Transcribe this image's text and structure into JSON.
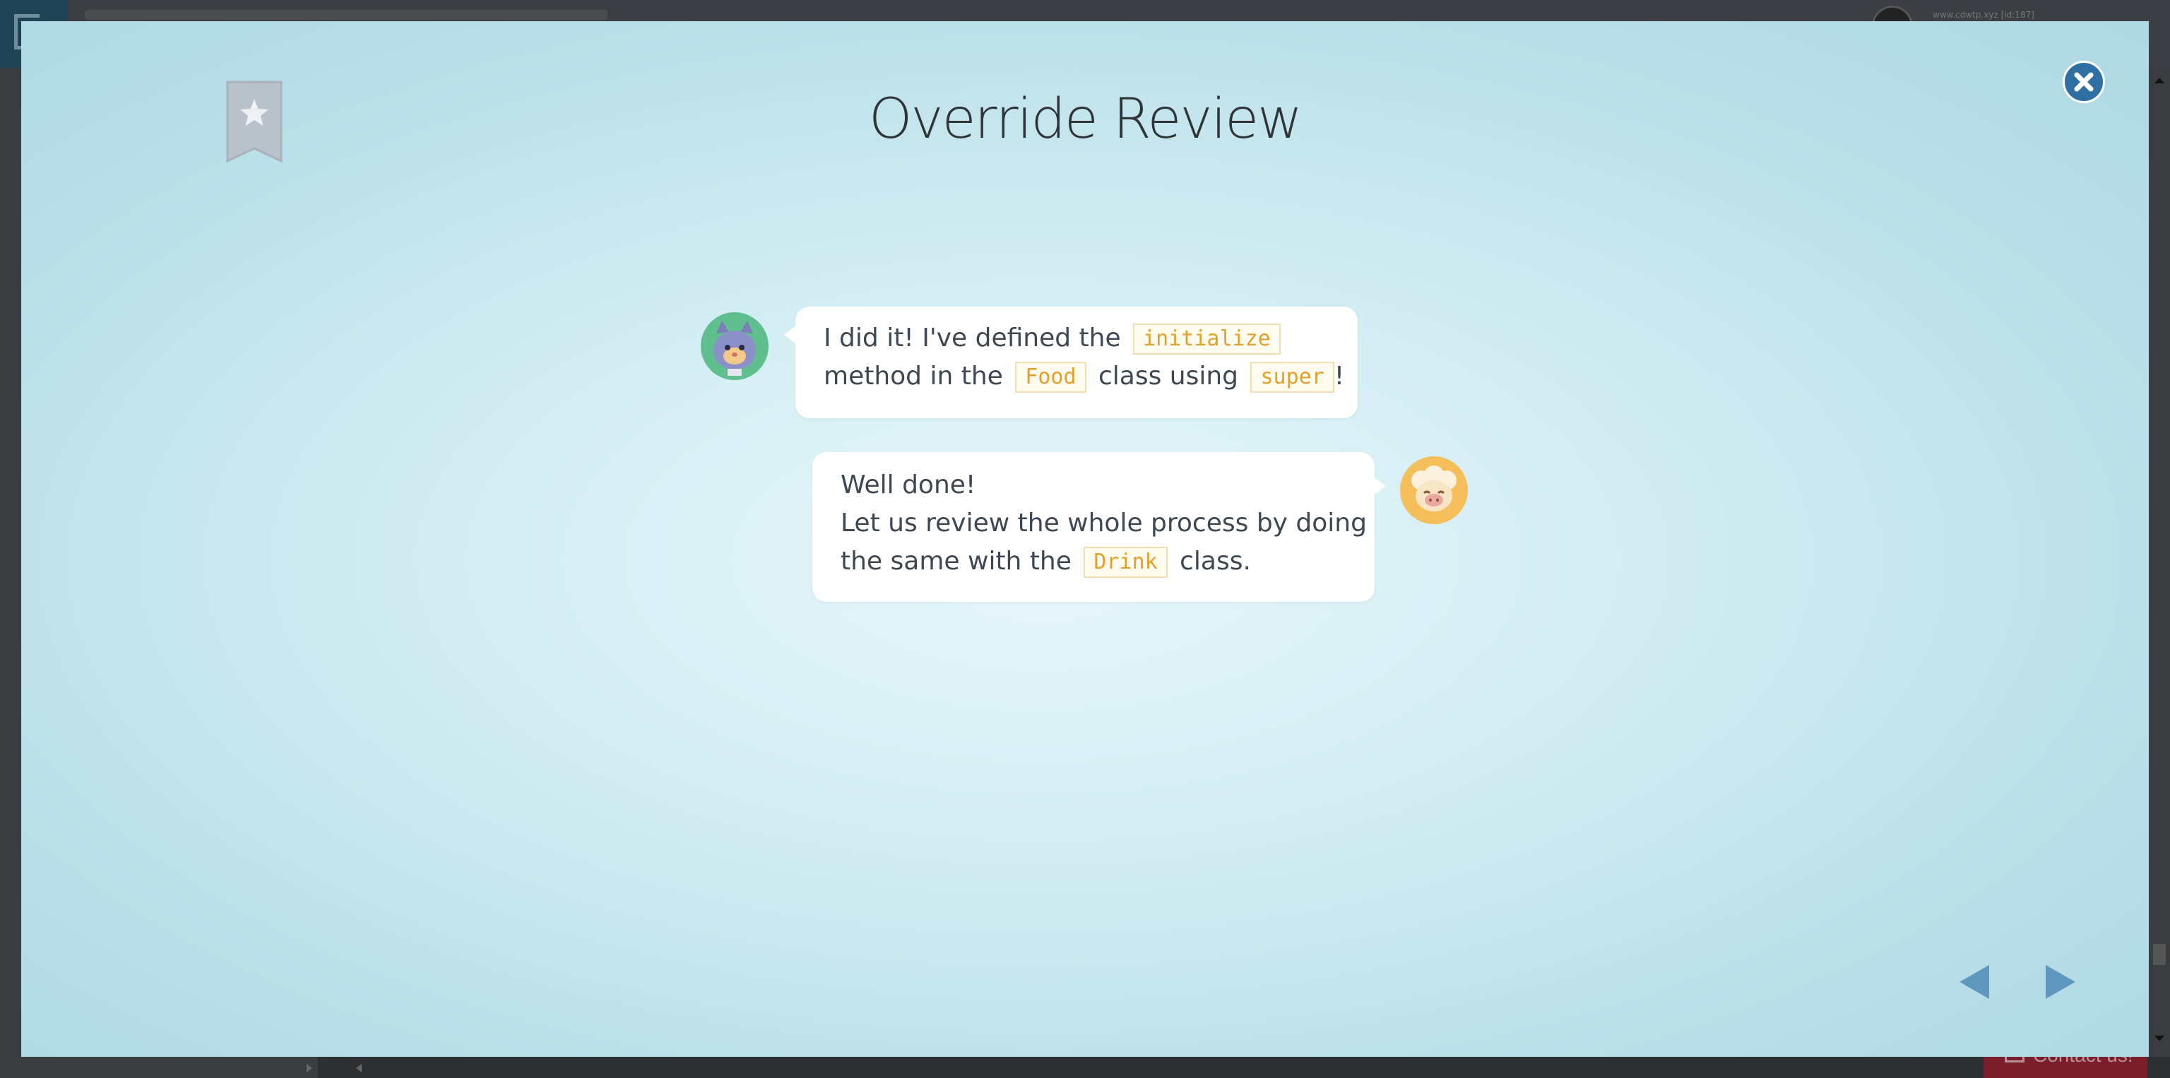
{
  "background_page": {
    "username": "www.cdwtp.xyz [id:187]",
    "contact_label": "Contact us!"
  },
  "modal": {
    "title": "Override Review",
    "messages": [
      {
        "speaker": "cat",
        "segments": {
          "t1": "I did it! I've defined the",
          "c1": "initialize",
          "t2": "method in the",
          "c2": "Food",
          "t3": "class using",
          "c3": "super",
          "t4": "!"
        }
      },
      {
        "speaker": "sheep",
        "segments": {
          "t1": "Well done!",
          "t2": "Let us review the whole process by doing",
          "t3": "the same with the",
          "c1": "Drink",
          "t4": "class."
        }
      }
    ]
  },
  "icons": {
    "bookmark": "bookmark-star-icon",
    "close": "close-icon",
    "prev": "triangle-left-icon",
    "next": "triangle-right-icon"
  },
  "colors": {
    "accent_blue": "#2e6fa4",
    "nav_arrow": "#5e98bf",
    "code_text": "#e3a02a",
    "cat_avatar_bg": "#5fbf8e",
    "sheep_avatar_bg": "#f4bf5b"
  }
}
